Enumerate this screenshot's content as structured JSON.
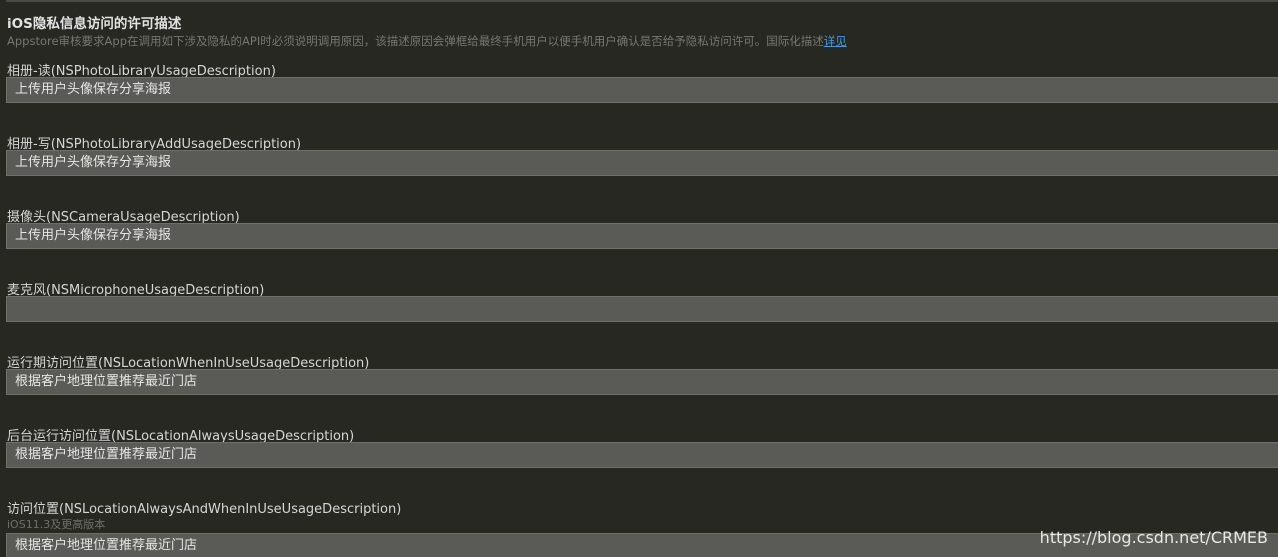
{
  "section": {
    "title": "iOS隐私信息访问的许可描述",
    "description": "Appstore审核要求App在调用如下涉及隐私的API时必须说明调用原因，该描述原因会弹框给最终手机用户以便手机用户确认是否给予隐私访问许可。国际化描述",
    "details_link": "详见"
  },
  "fields": [
    {
      "label": "相册-读(NSPhotoLibraryUsageDescription)",
      "value": "上传用户头像保存分享海报"
    },
    {
      "label": "相册-写(NSPhotoLibraryAddUsageDescription)",
      "value": "上传用户头像保存分享海报"
    },
    {
      "label": "摄像头(NSCameraUsageDescription)",
      "value": "上传用户头像保存分享海报"
    },
    {
      "label": "麦克风(NSMicrophoneUsageDescription)",
      "value": ""
    },
    {
      "label": "运行期访问位置(NSLocationWhenInUseUsageDescription)",
      "value": "根据客户地理位置推荐最近门店"
    },
    {
      "label": "后台运行访问位置(NSLocationAlwaysUsageDescription)",
      "value": "根据客户地理位置推荐最近门店"
    },
    {
      "label": "访问位置(NSLocationAlwaysAndWhenInUseUsageDescription)",
      "sublabel": "iOS11.3及更高版本",
      "value": "根据客户地理位置推荐最近门店"
    }
  ],
  "watermark": "https://blog.csdn.net/CRMEB"
}
